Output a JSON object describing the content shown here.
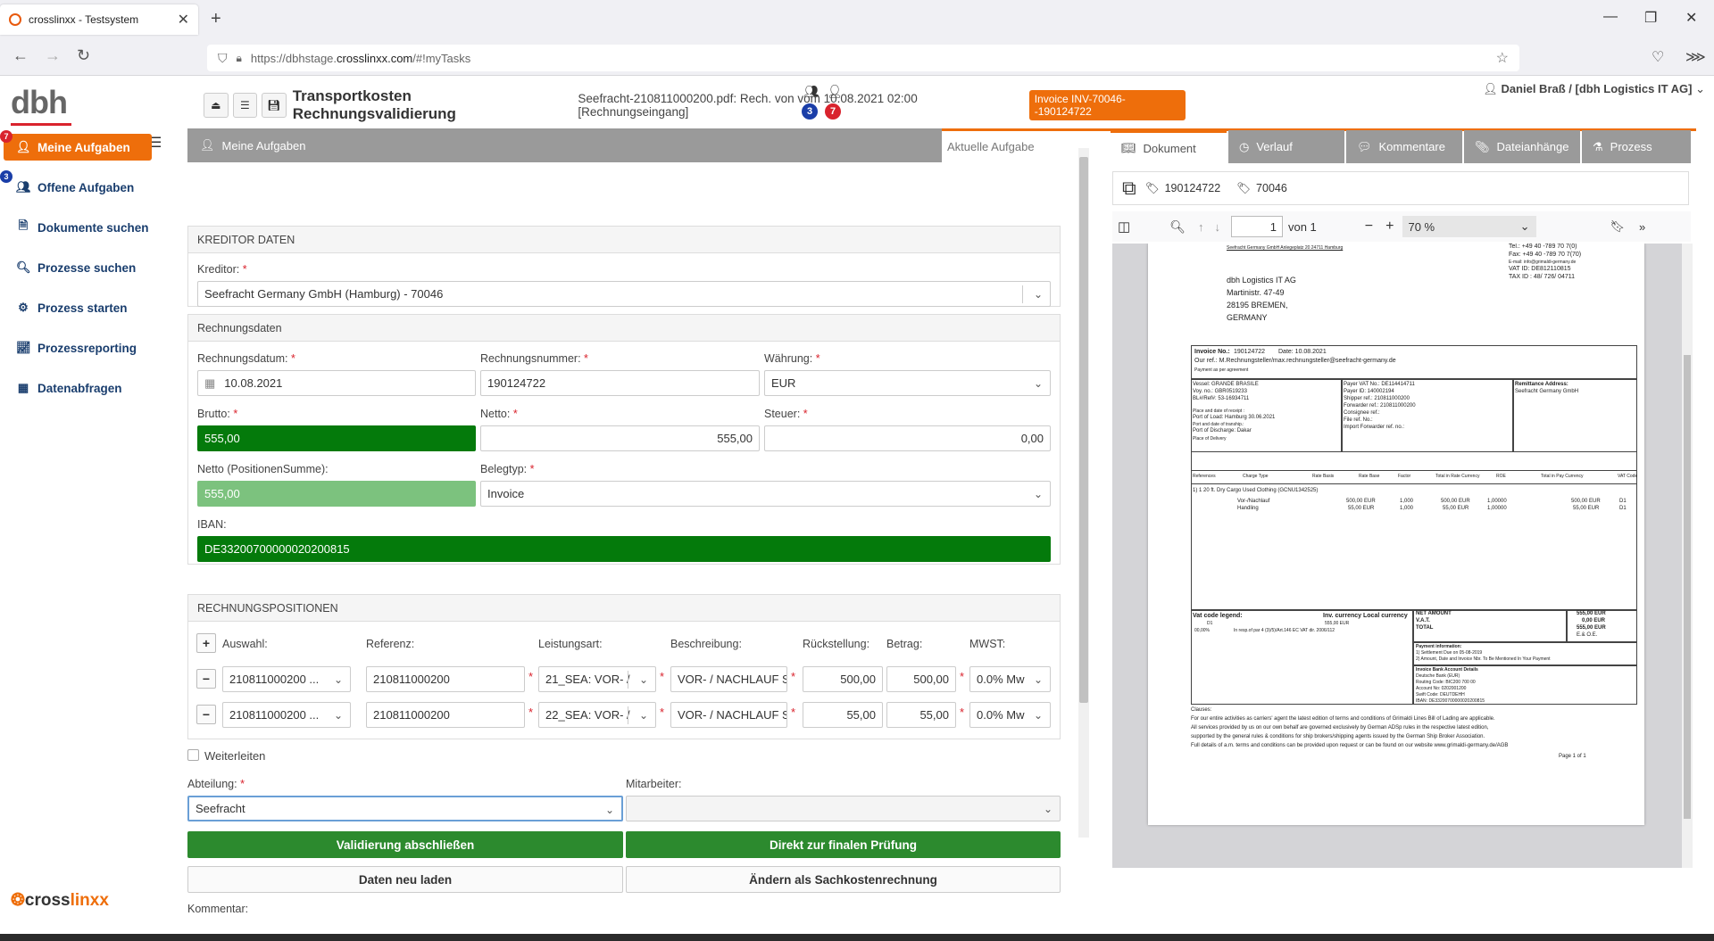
{
  "browser": {
    "tab_title": "crosslinxx - Testsystem",
    "url_prefix": "https://dbhstage.",
    "url_domain": "crosslinxx.com",
    "url_suffix": "/#!myTasks"
  },
  "header": {
    "logo": "dbh",
    "group_badge": "3",
    "user_badge": "7",
    "user": "Daniel Braß / [dbh Logistics IT AG]"
  },
  "sidebar": {
    "items": [
      {
        "label": "Meine Aufgaben",
        "icon": "user-icon",
        "badge": "7"
      },
      {
        "label": "Offene Aufgaben",
        "icon": "users-icon",
        "badge": "3"
      },
      {
        "label": "Dokumente suchen",
        "icon": "document-icon"
      },
      {
        "label": "Prozesse suchen",
        "icon": "search-icon"
      },
      {
        "label": "Prozess starten",
        "icon": "gear-icon"
      },
      {
        "label": "Prozessreporting",
        "icon": "report-icon"
      },
      {
        "label": "Datenabfragen",
        "icon": "table-icon"
      }
    ],
    "footer_brand_a": "cross",
    "footer_brand_b": "linxx"
  },
  "tabs": {
    "my_tasks": "Meine Aufgaben",
    "current": "Aktuelle Aufgabe"
  },
  "title": {
    "main": "Transportkosten Rechnungsvalidierung",
    "sub": "Seefracht-210811000200.pdf: Rech. von vom 10.08.2021 02:00 [Rechnungseingang]",
    "invoice_tag": "Invoice INV-70046--190124722"
  },
  "kreditor": {
    "section": "KREDITOR DATEN",
    "label": "Kreditor:",
    "value": "Seefracht Germany GmbH   (Hamburg) - 70046"
  },
  "rechnung": {
    "section": "Rechnungsdaten",
    "datum_label": "Rechnungsdatum:",
    "datum": "10.08.2021",
    "nummer_label": "Rechnungsnummer:",
    "nummer": "190124722",
    "waehrung_label": "Währung:",
    "waehrung": "EUR",
    "brutto_label": "Brutto:",
    "brutto": "555,00",
    "netto_label": "Netto:",
    "netto": "555,00",
    "steuer_label": "Steuer:",
    "steuer": "0,00",
    "netto_pos_label": "Netto (PositionenSumme):",
    "netto_pos": "555,00",
    "belegtyp_label": "Belegtyp:",
    "belegtyp": "Invoice",
    "iban_label": "IBAN:",
    "iban": "DE33200700000020200815"
  },
  "positionen": {
    "section": "RECHNUNGSPOSITIONEN",
    "headers": {
      "auswahl": "Auswahl:",
      "referenz": "Referenz:",
      "leistungsart": "Leistungsart:",
      "beschreibung": "Beschreibung:",
      "rueckstellung": "Rückstellung:",
      "betrag": "Betrag:",
      "mwst": "MWST:"
    },
    "rows": [
      {
        "auswahl": "210811000200 ...",
        "referenz": "210811000200",
        "leistungsart": "21_SEA: VOR- /",
        "beschreibung": "VOR- / NACHLAUF S",
        "rueckstellung": "500,00",
        "betrag": "500,00",
        "mwst": "0.0% Mw"
      },
      {
        "auswahl": "210811000200 ...",
        "referenz": "210811000200",
        "leistungsart": "22_SEA: VOR- /",
        "beschreibung": "VOR- / NACHLAUF S",
        "rueckstellung": "55,00",
        "betrag": "55,00",
        "mwst": "0.0% Mw"
      }
    ]
  },
  "footer_form": {
    "weiterleiten": "Weiterleiten",
    "abteilung_label": "Abteilung:",
    "abteilung": "Seefracht",
    "mitarbeiter_label": "Mitarbeiter:",
    "mitarbeiter": "",
    "btn_validate": "Validierung abschließen",
    "btn_final": "Direkt zur finalen Prüfung",
    "btn_reload": "Daten neu laden",
    "btn_sachkosten": "Ändern als Sachkostenrechnung",
    "kommentar_label": "Kommentar:"
  },
  "doc": {
    "tabs": [
      "Dokument",
      "Verlauf",
      "Kommentare",
      "Dateianhänge",
      "Prozess"
    ],
    "tag1": "190124722",
    "tag2": "70046",
    "page": "1",
    "of_pages": "von 1",
    "zoom": "70 %"
  },
  "pdf": {
    "sender_line": "Seefracht Germany GmbH  Anlegeplatz 20  24711 Hamburg",
    "contact1": "Tel.: +49 40 -789 70 7(0)",
    "contact2": "Fax: +49 40 -789 70 7(70)",
    "contact3": "E-mail: info@grimaldi-germany.de",
    "contact4": "VAT ID: DE812110815",
    "contact5": "TAX ID : 48/ 726/ 04711",
    "addr1": "dbh Logistics IT AG",
    "addr2": "Martinistr. 47-49",
    "addr3": "28195  BREMEN,",
    "addr4": "GERMANY",
    "inv_no_label": "Invoice No.:",
    "inv_no": "190124722",
    "date_label": "Date: 10.08.2021",
    "our_ref": "Our ref.: M.Rechnungsteller/max.rechnungsteller@seefracht-germany.de",
    "payment_note": "Payment as per agreement",
    "vessel": "Vessel:     GRANDE BRASILE",
    "voy": "Voy. no.:  GBR0519233",
    "bl": "BL#/Ref#:   53-16934711",
    "place_receipt": "Place and date of receipt :",
    "port_load": "Port of Load: Hamburg 30.06.2021",
    "port_trans": "Port and date of tranship.:",
    "port_dis": "Port of Discharge: Dakar",
    "place_del": "Place of Delivery",
    "payer_vat": "Payer VAT No.:     DE114414711",
    "payer_id": "Payer ID:             140002194",
    "shipper": "Shipper ref.:        210811000200",
    "forwarder": "Forwarder ref.:    210811000200",
    "consignee": "Consignee ref.:",
    "file_ref": "File ref. No.:",
    "import_fwd": "Import Forwarder ref. no.:",
    "remit_label": "Remittance Address:",
    "remit": "Seefracht Germany GmbH",
    "col_headers": [
      "References",
      "Charge Type",
      "Rate Basis",
      "Rate Base",
      "Factor",
      "Total in Rate Currency",
      "ROE",
      "Total in Pay Currency",
      "VAT Code"
    ],
    "cargo_line": "1) 1 20 ft. Dry Cargo Used Clothing (GCNU1342525)",
    "line1_desc": "Vor-/Nachlauf",
    "line1_rate": "500,00 EUR",
    "line1_factor": "1,000",
    "line1_total": "500,00 EUR",
    "line1_roe": "1,00000",
    "line1_pay": "500,00 EUR",
    "line1_vat": "D1",
    "line2_desc": "Handling",
    "line2_rate": "55,00 EUR",
    "line2_factor": "1,000",
    "line2_total": "55,00 EUR",
    "line2_roe": "1,00000",
    "line2_pay": "55,00 EUR",
    "line2_vat": "D1",
    "vat_legend": "Vat code legend:",
    "inv_curr": "Inv. currency  Local currency",
    "vat_d1": "D1",
    "vat_d1_amt": "555,00 EUR",
    "vat_pct": "00,00%",
    "vat_note": "In resp.of par 4 (3)/5)/Art.146 EC VAT dir. 2006/112",
    "net_label": "NET AMOUNT",
    "net_val": "555,00 EUR",
    "vat_label": "V.A.T.",
    "vat_val": "0,00 EUR",
    "total_label": "TOTAL",
    "total_val": "555,00 EUR",
    "eoe": "E.& O.E.",
    "pay_info": "Payment information:",
    "pay1": "1) Settlement  Due on 05-08-2019",
    "pay2": "2) Amount, Date and Invoice Nbr. To Be Mentioned In Your Payment",
    "bank_title": "Invoice Bank Account Details",
    "bank1": "Deutsche Bank (EUR)",
    "bank2": "Routing Code: BIC200 700 00",
    "bank3": "Account No: 0202001200",
    "bank4": "Swift Code: DEUTDEHH",
    "bank5": "IBAN: DE33200700000020200815",
    "clauses": "Clauses:",
    "cl1": "For our entire activities as carriers' agent the latest edition of terms and conditions of Grimaldi Lines Bill of Lading are applicable.",
    "cl2": "All services provided by us on our own behalf are governed exclusively by German ADSp rules in the respective latest edition,",
    "cl3": "supported by the general rules & conditions for ship brokers/shipping agents issued by the German Ship Broker Association.",
    "cl4": "Full details of a.m. terms and conditions can be provided upon request or can be found on our website www.grimaldi-germany.de/AGB",
    "page_of": "Page 1 of 1"
  }
}
